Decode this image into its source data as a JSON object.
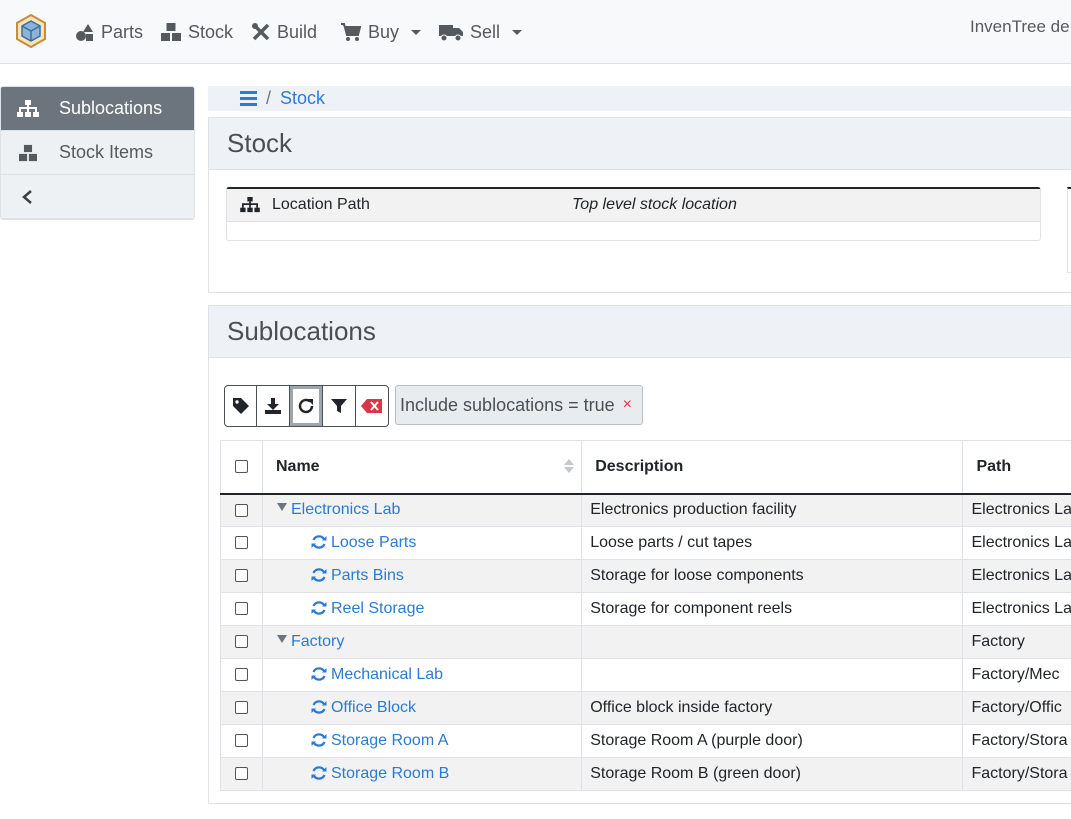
{
  "colors": {
    "link": "#2b7bd4",
    "active_sidebar": "#6c757d",
    "danger": "#dc3545"
  },
  "navbar": {
    "logo_icon": "inventree-cube-icon",
    "items": [
      {
        "label": "Parts",
        "icon": "shapes-icon"
      },
      {
        "label": "Stock",
        "icon": "boxes-icon"
      },
      {
        "label": "Build",
        "icon": "tools-icon"
      },
      {
        "label": "Buy",
        "icon": "shopping-cart-icon",
        "dropdown": true
      },
      {
        "label": "Sell",
        "icon": "truck-icon",
        "dropdown": true
      }
    ],
    "brand_right": "InvenTree de"
  },
  "sidebar": {
    "items": [
      {
        "label": "Sublocations",
        "icon": "sitemap-icon",
        "active": true
      },
      {
        "label": "Stock Items",
        "icon": "boxes-icon",
        "active": false
      }
    ],
    "collapse_icon": "chevron-left-icon"
  },
  "breadcrumb": {
    "menu_icon": "bars-icon",
    "separator": "/",
    "current": "Stock"
  },
  "stock_panel": {
    "title": "Stock",
    "info": {
      "label": "Location Path",
      "value": "Top level stock location",
      "icon": "sitemap-icon"
    }
  },
  "sublocations_panel": {
    "title": "Sublocations",
    "toolbar": [
      "tag-icon",
      "download-icon",
      "refresh-icon",
      "filter-icon",
      "clear-filter-icon"
    ],
    "filter_chip": {
      "text": "Include sublocations = true",
      "remove": "×"
    },
    "columns": {
      "name": "Name",
      "description": "Description",
      "path": "Path"
    },
    "rows": [
      {
        "name": "Electronics Lab",
        "description": "Electronics production facility",
        "path": "Electronics La",
        "level": 0
      },
      {
        "name": "Loose Parts",
        "description": "Loose parts / cut tapes",
        "path": "Electronics La",
        "level": 1
      },
      {
        "name": "Parts Bins",
        "description": "Storage for loose components",
        "path": "Electronics La",
        "level": 1
      },
      {
        "name": "Reel Storage",
        "description": "Storage for component reels",
        "path": "Electronics La",
        "level": 1
      },
      {
        "name": "Factory",
        "description": "",
        "path": "Factory",
        "level": 0
      },
      {
        "name": "Mechanical Lab",
        "description": "",
        "path": "Factory/Mec",
        "level": 1
      },
      {
        "name": "Office Block",
        "description": "Office block inside factory",
        "path": "Factory/Offic",
        "level": 1
      },
      {
        "name": "Storage Room A",
        "description": "Storage Room A (purple door)",
        "path": "Factory/Stora",
        "level": 1
      },
      {
        "name": "Storage Room B",
        "description": "Storage Room B (green door)",
        "path": "Factory/Stora",
        "level": 1
      }
    ]
  }
}
